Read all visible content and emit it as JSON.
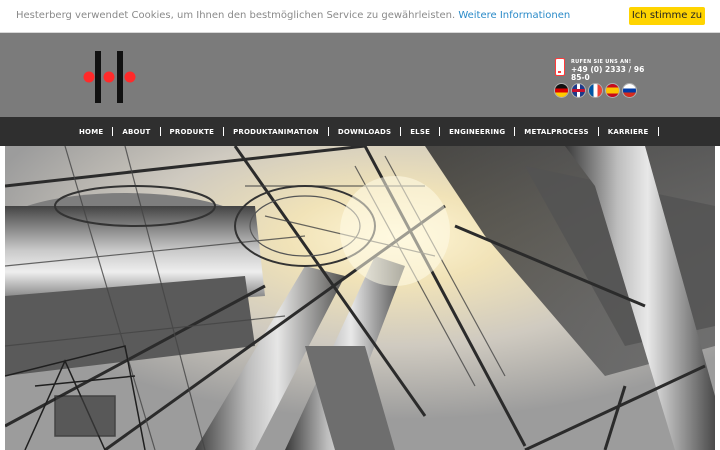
{
  "cookie": {
    "text": "Hesterberg verwendet Cookies, um Ihnen den bestmöglichen Service zu gewährleisten.",
    "link": "Weitere Informationen",
    "button": "Ich stimme zu"
  },
  "header": {
    "call_label": "RUFEN SIE UNS AN!",
    "phone": "+49 (0) 2333 / 96 85-0",
    "logo_icon": "hesterberg-logo",
    "phone_icon": "phone-icon",
    "flags": [
      "flag-germany",
      "flag-uk",
      "flag-france",
      "flag-spain",
      "flag-russia"
    ]
  },
  "nav": {
    "items": [
      "HOME",
      "ABOUT",
      "PRODUKTE",
      "PRODUKTANIMATION",
      "DOWNLOADS",
      "ELSE",
      "ENGINEERING",
      "METALPROCESS",
      "KARRIERE"
    ]
  },
  "colors": {
    "cookie_button": "#ffd400",
    "header_bg": "#7b7b7b",
    "nav_bg": "#2f2f2f",
    "logo_red": "#ff2a2a",
    "link": "#2a8ac8"
  }
}
